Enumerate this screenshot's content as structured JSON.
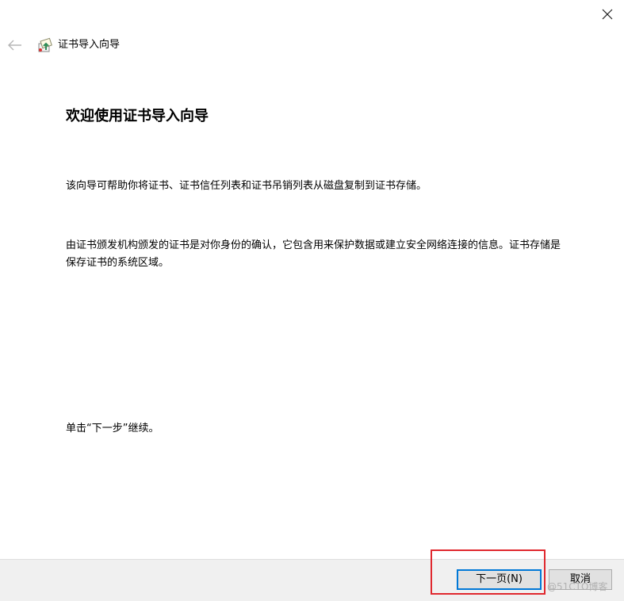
{
  "window": {
    "title": "证书导入向导",
    "close_icon": "close-icon",
    "back_icon": "back-arrow-icon",
    "app_icon": "certificate-wizard-icon"
  },
  "content": {
    "heading": "欢迎使用证书导入向导",
    "paragraph1": "该向导可帮助你将证书、证书信任列表和证书吊销列表从磁盘复制到证书存储。",
    "paragraph2": "由证书颁发机构颁发的证书是对你身份的确认，它包含用来保护数据或建立安全网络连接的信息。证书存储是保存证书的系统区域。",
    "paragraph3": "单击“下一步”继续。"
  },
  "footer": {
    "next_label": "下一页(N)",
    "cancel_label": "取消"
  },
  "overlay": {
    "watermark": "@51CTO博客",
    "highlight_color": "#e0282e"
  },
  "colors": {
    "accent": "#0078d7",
    "footer_bg": "#f0f0f0"
  }
}
